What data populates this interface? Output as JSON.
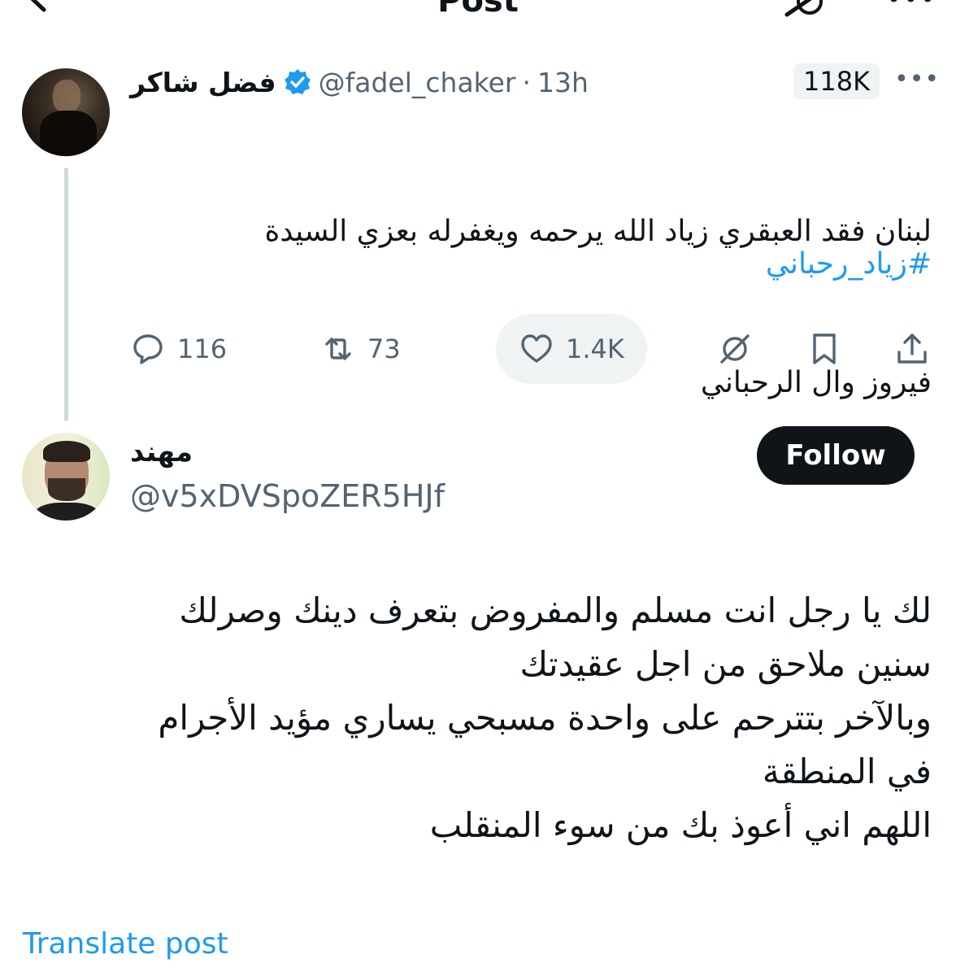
{
  "header": {
    "title": "Post"
  },
  "original_post": {
    "display_name": "فضل شاكر",
    "handle": "@fadel_chaker",
    "separator": "·",
    "time": "13h",
    "views_badge": "118K",
    "text_lines": [
      "لبنان فقد العبقري زياد الله يرحمه ويغفرله بعزي السيدة",
      "فيروز وال الرحباني"
    ],
    "hashtag": "#زياد_رحباني",
    "stats": {
      "replies": "116",
      "reposts": "73",
      "likes": "1.4K"
    }
  },
  "reply": {
    "display_name": "مهند",
    "handle": "@v5xDVSpoZER5HJf",
    "follow_label": "Follow",
    "text_lines": [
      "لك يا رجل انت مسلم والمفروض بتعرف دينك وصرلك",
      "سنين ملاحق من اجل عقيدتك",
      "وبالآخر بتترحم على واحدة مسبحي  يساري مؤيد الأجرام",
      "في المنطقة",
      "اللهم اني أعوذ بك من سوء المنقلب"
    ]
  },
  "translate_link": "Translate post",
  "colors": {
    "accent": "#1d9bf0",
    "text": "#0f1419",
    "muted": "#536471",
    "pill_bg": "#eff3f4"
  },
  "icons": [
    "back-arrow-icon",
    "grok-icon",
    "more-icon",
    "verified-icon",
    "reply-icon",
    "repost-icon",
    "like-icon",
    "grok-analyze-icon",
    "bookmark-icon",
    "share-icon"
  ]
}
